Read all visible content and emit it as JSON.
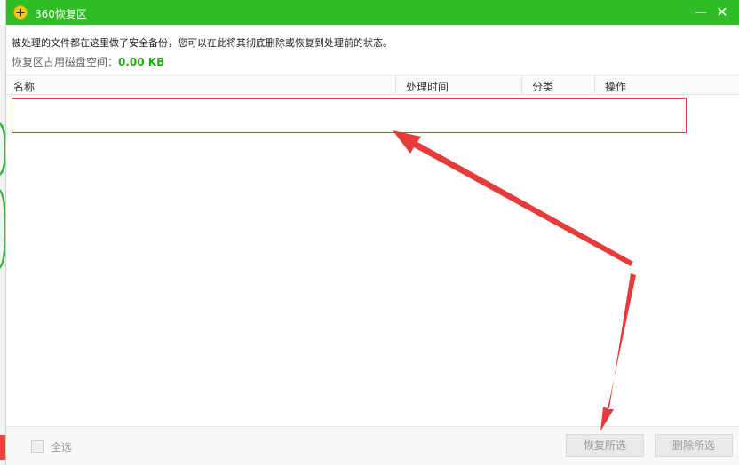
{
  "window": {
    "title": "360恢复区",
    "minimize_glyph": "—",
    "close_glyph": "✕"
  },
  "info": {
    "notice": "被处理的文件都在这里做了安全备份，您可以在此将其彻底删除或恢复到处理前的状态。",
    "space_label": "恢复区占用磁盘空间：",
    "space_value": "0.00 KB"
  },
  "table": {
    "columns": [
      "名称",
      "处理时间",
      "分类",
      "操作"
    ],
    "rows": []
  },
  "footer": {
    "select_all_label": "全选",
    "restore_button": "恢复所选",
    "delete_button": "删除所选"
  },
  "colors": {
    "titlebar": "#2fbd26",
    "space_value": "#25a71b",
    "annotation": "#e53b3b"
  },
  "icons": {
    "app": "360-logo-icon",
    "minimize": "minimize-icon",
    "close": "close-icon"
  }
}
